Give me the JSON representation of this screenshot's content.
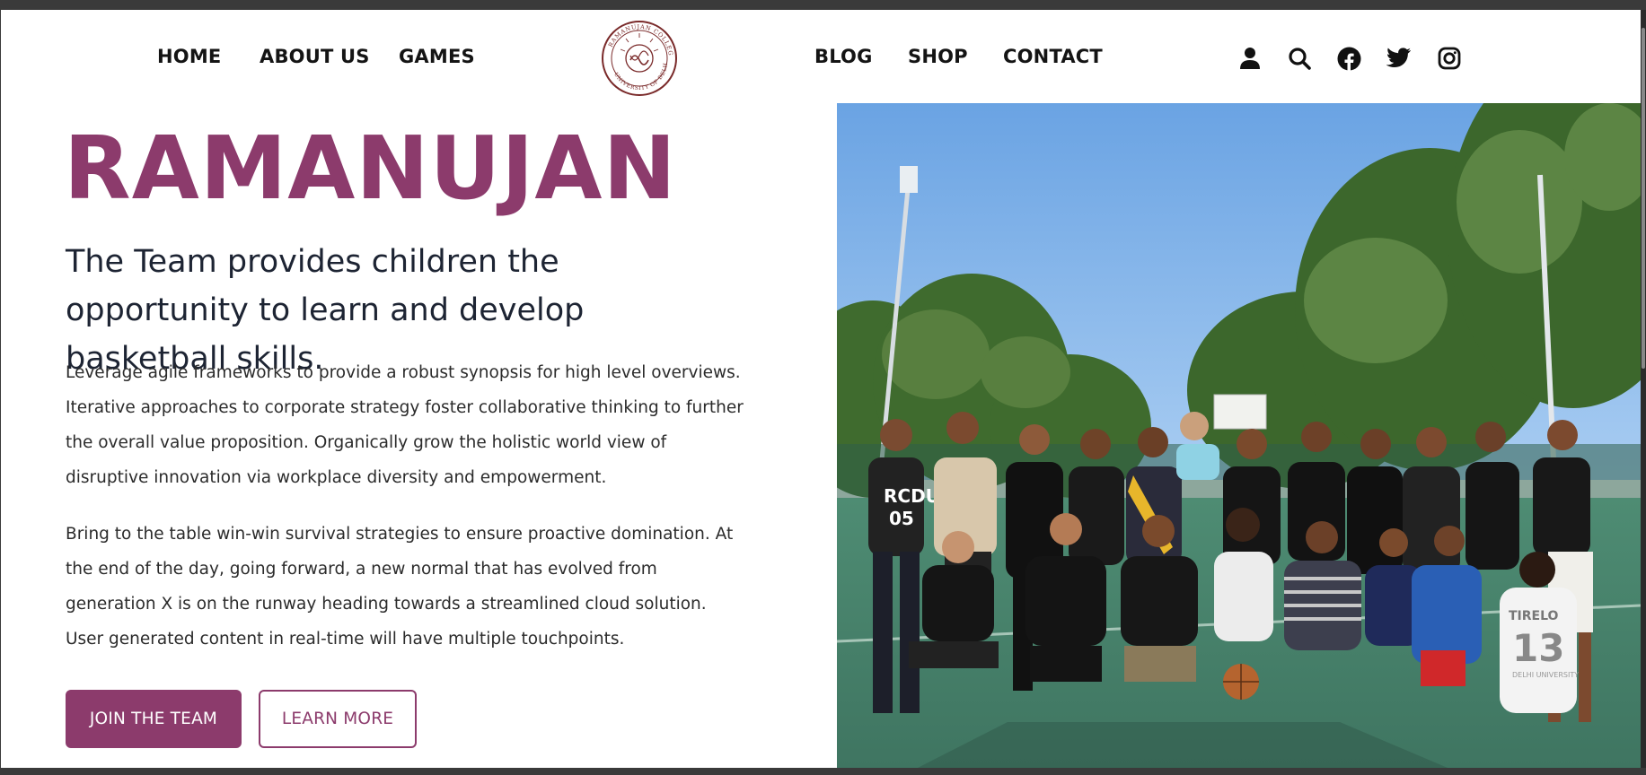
{
  "header": {
    "nav_left": [
      "HOME",
      "ABOUT US",
      "GAMES"
    ],
    "nav_right": [
      "BLOG",
      "SHOP",
      "CONTACT"
    ],
    "logo_text": "RAMANUJAN COLLEGE · UNIVERSITY OF DELHI",
    "icons": [
      "user-icon",
      "search-icon",
      "facebook-icon",
      "twitter-icon",
      "instagram-icon"
    ]
  },
  "hero": {
    "title": "RAMANUJAN",
    "subtitle": "The Team provides children the opportunity to learn and develop basketball skills.",
    "paragraph_1": "Leverage agile frameworks to provide a robust synopsis for high level overviews. Iterative approaches to corporate strategy foster collaborative thinking to further the overall value proposition. Organically grow the holistic world view of disruptive innovation via workplace diversity and empowerment.",
    "paragraph_2": "Bring to the table win-win survival strategies to ensure proactive domination. At the end of the day, going forward, a new normal that has evolved from generation X is on the runway heading towards a streamlined cloud solution. User generated content in real-time will have multiple touchpoints.",
    "primary_button": "JOIN THE TEAM",
    "secondary_button": "LEARN MORE"
  },
  "photo": {
    "jersey_text_1": "RCDU",
    "jersey_number_1": "05",
    "jersey_text_2": "TIRELO",
    "jersey_number_2": "13",
    "jersey_text_3": "DELHI UNIVERSITY"
  },
  "colors": {
    "accent": "#8c3b6c",
    "text": "#1d2433",
    "sky": "#7eb0e6",
    "court": "#4f8a72"
  }
}
